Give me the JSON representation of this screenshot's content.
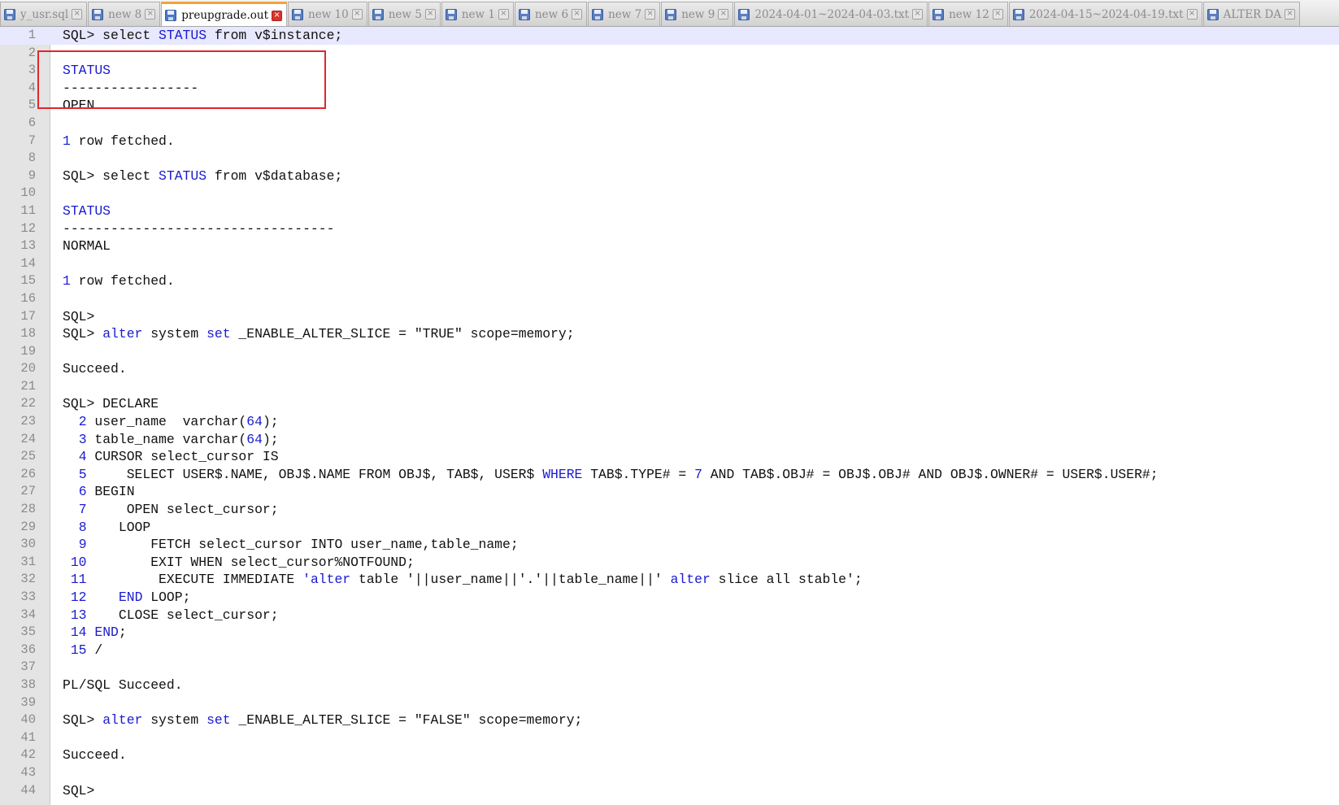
{
  "tabs": [
    {
      "label": "y_usr.sql",
      "active": false
    },
    {
      "label": "new  8",
      "active": false
    },
    {
      "label": "preupgrade.out",
      "active": true
    },
    {
      "label": "new  10",
      "active": false
    },
    {
      "label": "new  5",
      "active": false
    },
    {
      "label": "new  1",
      "active": false
    },
    {
      "label": "new  6",
      "active": false
    },
    {
      "label": "new  7",
      "active": false
    },
    {
      "label": "new  9",
      "active": false
    },
    {
      "label": "2024-04-01~2024-04-03.txt",
      "active": false
    },
    {
      "label": "new  12",
      "active": false
    },
    {
      "label": "2024-04-15~2024-04-19.txt",
      "active": false
    },
    {
      "label": "ALTER DA",
      "active": false
    }
  ],
  "icons": {
    "tab_file": "floppy-disk-icon",
    "tab_close": "close-icon"
  },
  "colors": {
    "keyword": "#1a1ad0",
    "highlight_box": "#e0262a",
    "active_tab_accent": "#f2a33a",
    "current_line": "#e8e8ff"
  },
  "editor": {
    "current_line": 1,
    "lines": [
      [
        [
          "SQL> select ",
          ""
        ],
        [
          "STATUS",
          "kw"
        ],
        [
          " from v$instance;",
          ""
        ]
      ],
      [],
      [
        [
          "STATUS",
          "kw"
        ]
      ],
      [
        [
          "-----------------",
          ""
        ]
      ],
      [
        [
          "OPEN",
          ""
        ]
      ],
      [],
      [
        [
          "1",
          "num"
        ],
        [
          " row fetched.",
          ""
        ]
      ],
      [],
      [
        [
          "SQL> select ",
          ""
        ],
        [
          "STATUS",
          "kw"
        ],
        [
          " from v$database;",
          ""
        ]
      ],
      [],
      [
        [
          "STATUS",
          "kw"
        ]
      ],
      [
        [
          "----------------------------------",
          ""
        ]
      ],
      [
        [
          "NORMAL",
          ""
        ]
      ],
      [],
      [
        [
          "1",
          "num"
        ],
        [
          " row fetched.",
          ""
        ]
      ],
      [],
      [
        [
          "SQL>",
          ""
        ]
      ],
      [
        [
          "SQL> ",
          ""
        ],
        [
          "alter",
          "kw"
        ],
        [
          " system ",
          ""
        ],
        [
          "set",
          "kw"
        ],
        [
          " _ENABLE_ALTER_SLICE = \"TRUE\" scope=memory;",
          ""
        ]
      ],
      [],
      [
        [
          "Succeed.",
          ""
        ]
      ],
      [],
      [
        [
          "SQL> DECLARE",
          ""
        ]
      ],
      [
        [
          "  ",
          ""
        ],
        [
          "2",
          "num"
        ],
        [
          " user_name  varchar(",
          ""
        ],
        [
          "64",
          "num"
        ],
        [
          ");",
          ""
        ]
      ],
      [
        [
          "  ",
          ""
        ],
        [
          "3",
          "num"
        ],
        [
          " table_name varchar(",
          ""
        ],
        [
          "64",
          "num"
        ],
        [
          ");",
          ""
        ]
      ],
      [
        [
          "  ",
          ""
        ],
        [
          "4",
          "num"
        ],
        [
          " CURSOR select_cursor IS",
          ""
        ]
      ],
      [
        [
          "  ",
          ""
        ],
        [
          "5",
          "num"
        ],
        [
          "     SELECT USER$.NAME, OBJ$.NAME FROM OBJ$, TAB$, USER$ ",
          ""
        ],
        [
          "WHERE",
          "kw"
        ],
        [
          " TAB$.TYPE# = ",
          ""
        ],
        [
          "7",
          "num"
        ],
        [
          " AND TAB$.OBJ# = OBJ$.OBJ# AND OBJ$.OWNER# = USER$.USER#;",
          ""
        ]
      ],
      [
        [
          "  ",
          ""
        ],
        [
          "6",
          "num"
        ],
        [
          " BEGIN",
          ""
        ]
      ],
      [
        [
          "  ",
          ""
        ],
        [
          "7",
          "num"
        ],
        [
          "     OPEN select_cursor;",
          ""
        ]
      ],
      [
        [
          "  ",
          ""
        ],
        [
          "8",
          "num"
        ],
        [
          "    LOOP",
          ""
        ]
      ],
      [
        [
          "  ",
          ""
        ],
        [
          "9",
          "num"
        ],
        [
          "        FETCH select_cursor INTO user_name,table_name;",
          ""
        ]
      ],
      [
        [
          " ",
          ""
        ],
        [
          "10",
          "num"
        ],
        [
          "        EXIT WHEN select_cursor%NOTFOUND;",
          ""
        ]
      ],
      [
        [
          " ",
          ""
        ],
        [
          "11",
          "num"
        ],
        [
          "         EXECUTE IMMEDIATE ",
          ""
        ],
        [
          "'alter",
          "str"
        ],
        [
          " table '||user_name||'.'||table_name||' ",
          ""
        ],
        [
          "alter",
          "kw"
        ],
        [
          " slice all stable';",
          ""
        ]
      ],
      [
        [
          " ",
          ""
        ],
        [
          "12",
          "num"
        ],
        [
          "    ",
          ""
        ],
        [
          "END",
          "kw"
        ],
        [
          " LOOP;",
          ""
        ]
      ],
      [
        [
          " ",
          ""
        ],
        [
          "13",
          "num"
        ],
        [
          "    CLOSE select_cursor;",
          ""
        ]
      ],
      [
        [
          " ",
          ""
        ],
        [
          "14",
          "num"
        ],
        [
          " ",
          ""
        ],
        [
          "END",
          "kw"
        ],
        [
          ";",
          ""
        ]
      ],
      [
        [
          " ",
          ""
        ],
        [
          "15",
          "num"
        ],
        [
          " /",
          ""
        ]
      ],
      [],
      [
        [
          "PL/SQL Succeed.",
          ""
        ]
      ],
      [],
      [
        [
          "SQL> ",
          ""
        ],
        [
          "alter",
          "kw"
        ],
        [
          " system ",
          ""
        ],
        [
          "set",
          "kw"
        ],
        [
          " _ENABLE_ALTER_SLICE = \"FALSE\" scope=memory;",
          ""
        ]
      ],
      [],
      [
        [
          "Succeed.",
          ""
        ]
      ],
      [],
      [
        [
          "SQL>",
          ""
        ]
      ]
    ]
  }
}
